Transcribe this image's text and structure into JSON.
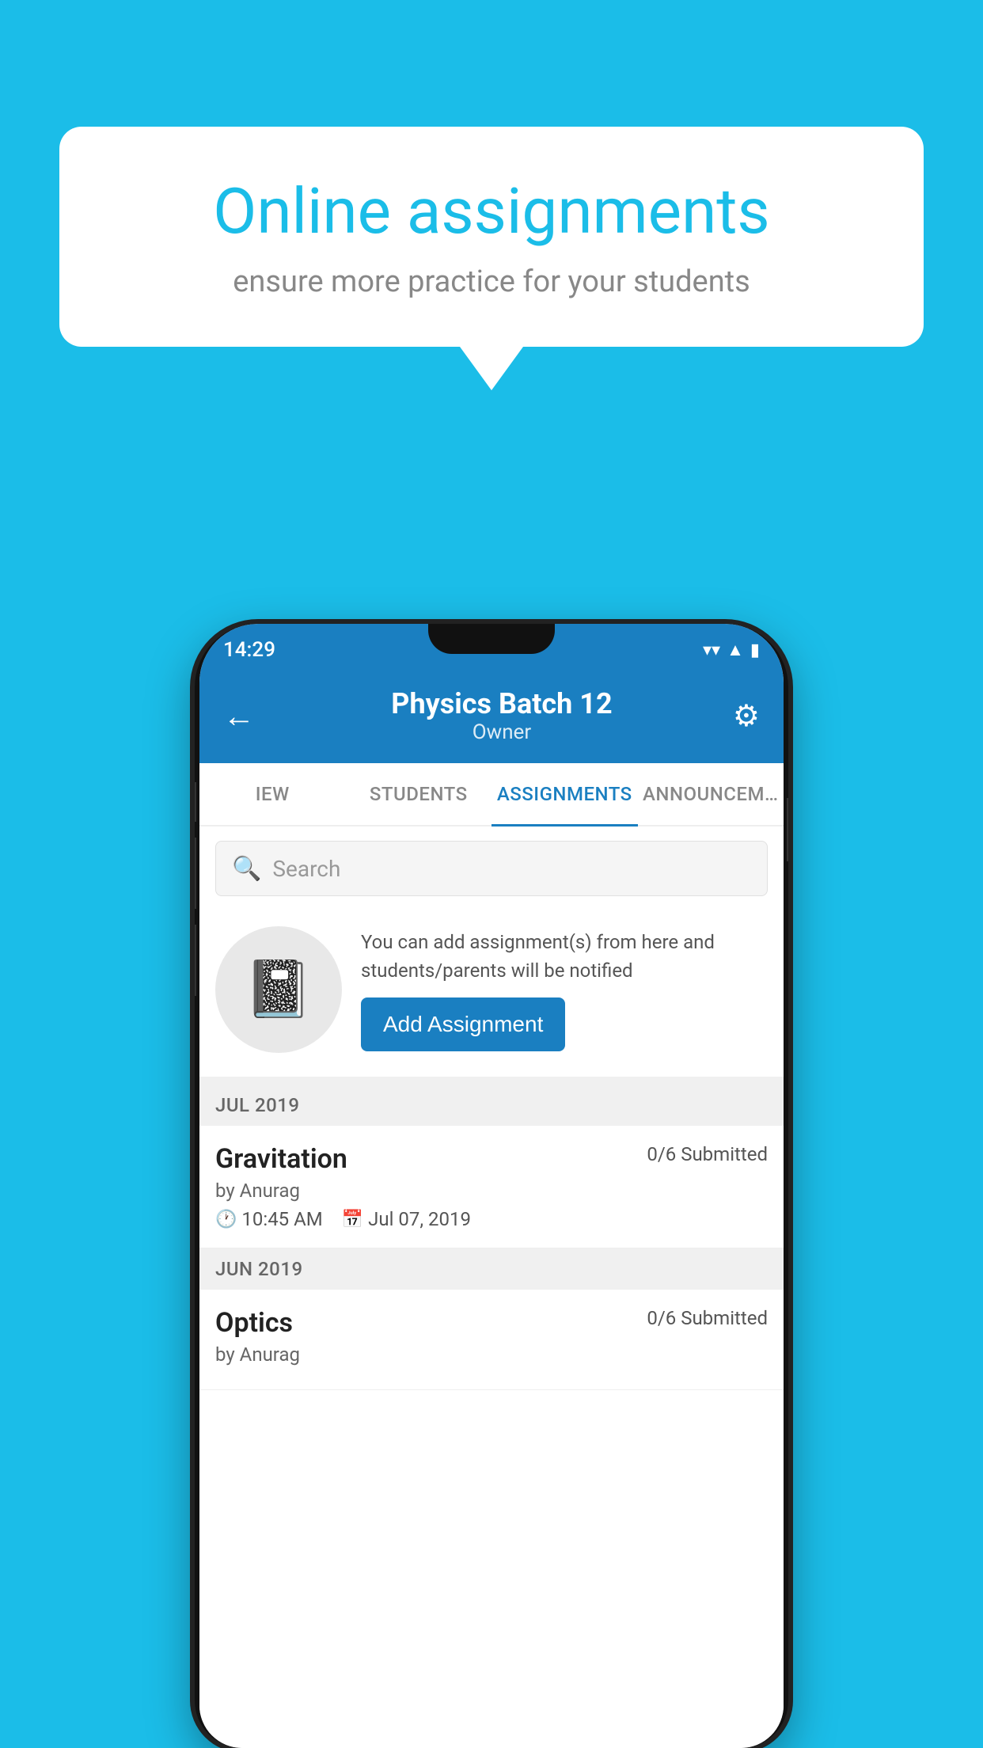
{
  "background_color": "#1bbde8",
  "speech_bubble": {
    "title": "Online assignments",
    "subtitle": "ensure more practice for your students"
  },
  "status_bar": {
    "time": "14:29",
    "wifi_icon": "▼",
    "signal_icon": "▲",
    "battery_icon": "▮"
  },
  "app_bar": {
    "title": "Physics Batch 12",
    "subtitle": "Owner",
    "back_icon": "←",
    "settings_icon": "⚙"
  },
  "tabs": [
    {
      "label": "IEW",
      "active": false
    },
    {
      "label": "STUDENTS",
      "active": false
    },
    {
      "label": "ASSIGNMENTS",
      "active": true
    },
    {
      "label": "ANNOUNCEM…",
      "active": false
    }
  ],
  "search": {
    "placeholder": "Search",
    "icon": "🔍"
  },
  "promo": {
    "description": "You can add assignment(s) from here and students/parents will be notified",
    "button_label": "Add Assignment"
  },
  "sections": [
    {
      "month": "JUL 2019",
      "assignments": [
        {
          "name": "Gravitation",
          "submitted": "0/6 Submitted",
          "by": "by Anurag",
          "time": "10:45 AM",
          "date": "Jul 07, 2019"
        }
      ]
    },
    {
      "month": "JUN 2019",
      "assignments": [
        {
          "name": "Optics",
          "submitted": "0/6 Submitted",
          "by": "by Anurag",
          "time": "",
          "date": ""
        }
      ]
    }
  ]
}
